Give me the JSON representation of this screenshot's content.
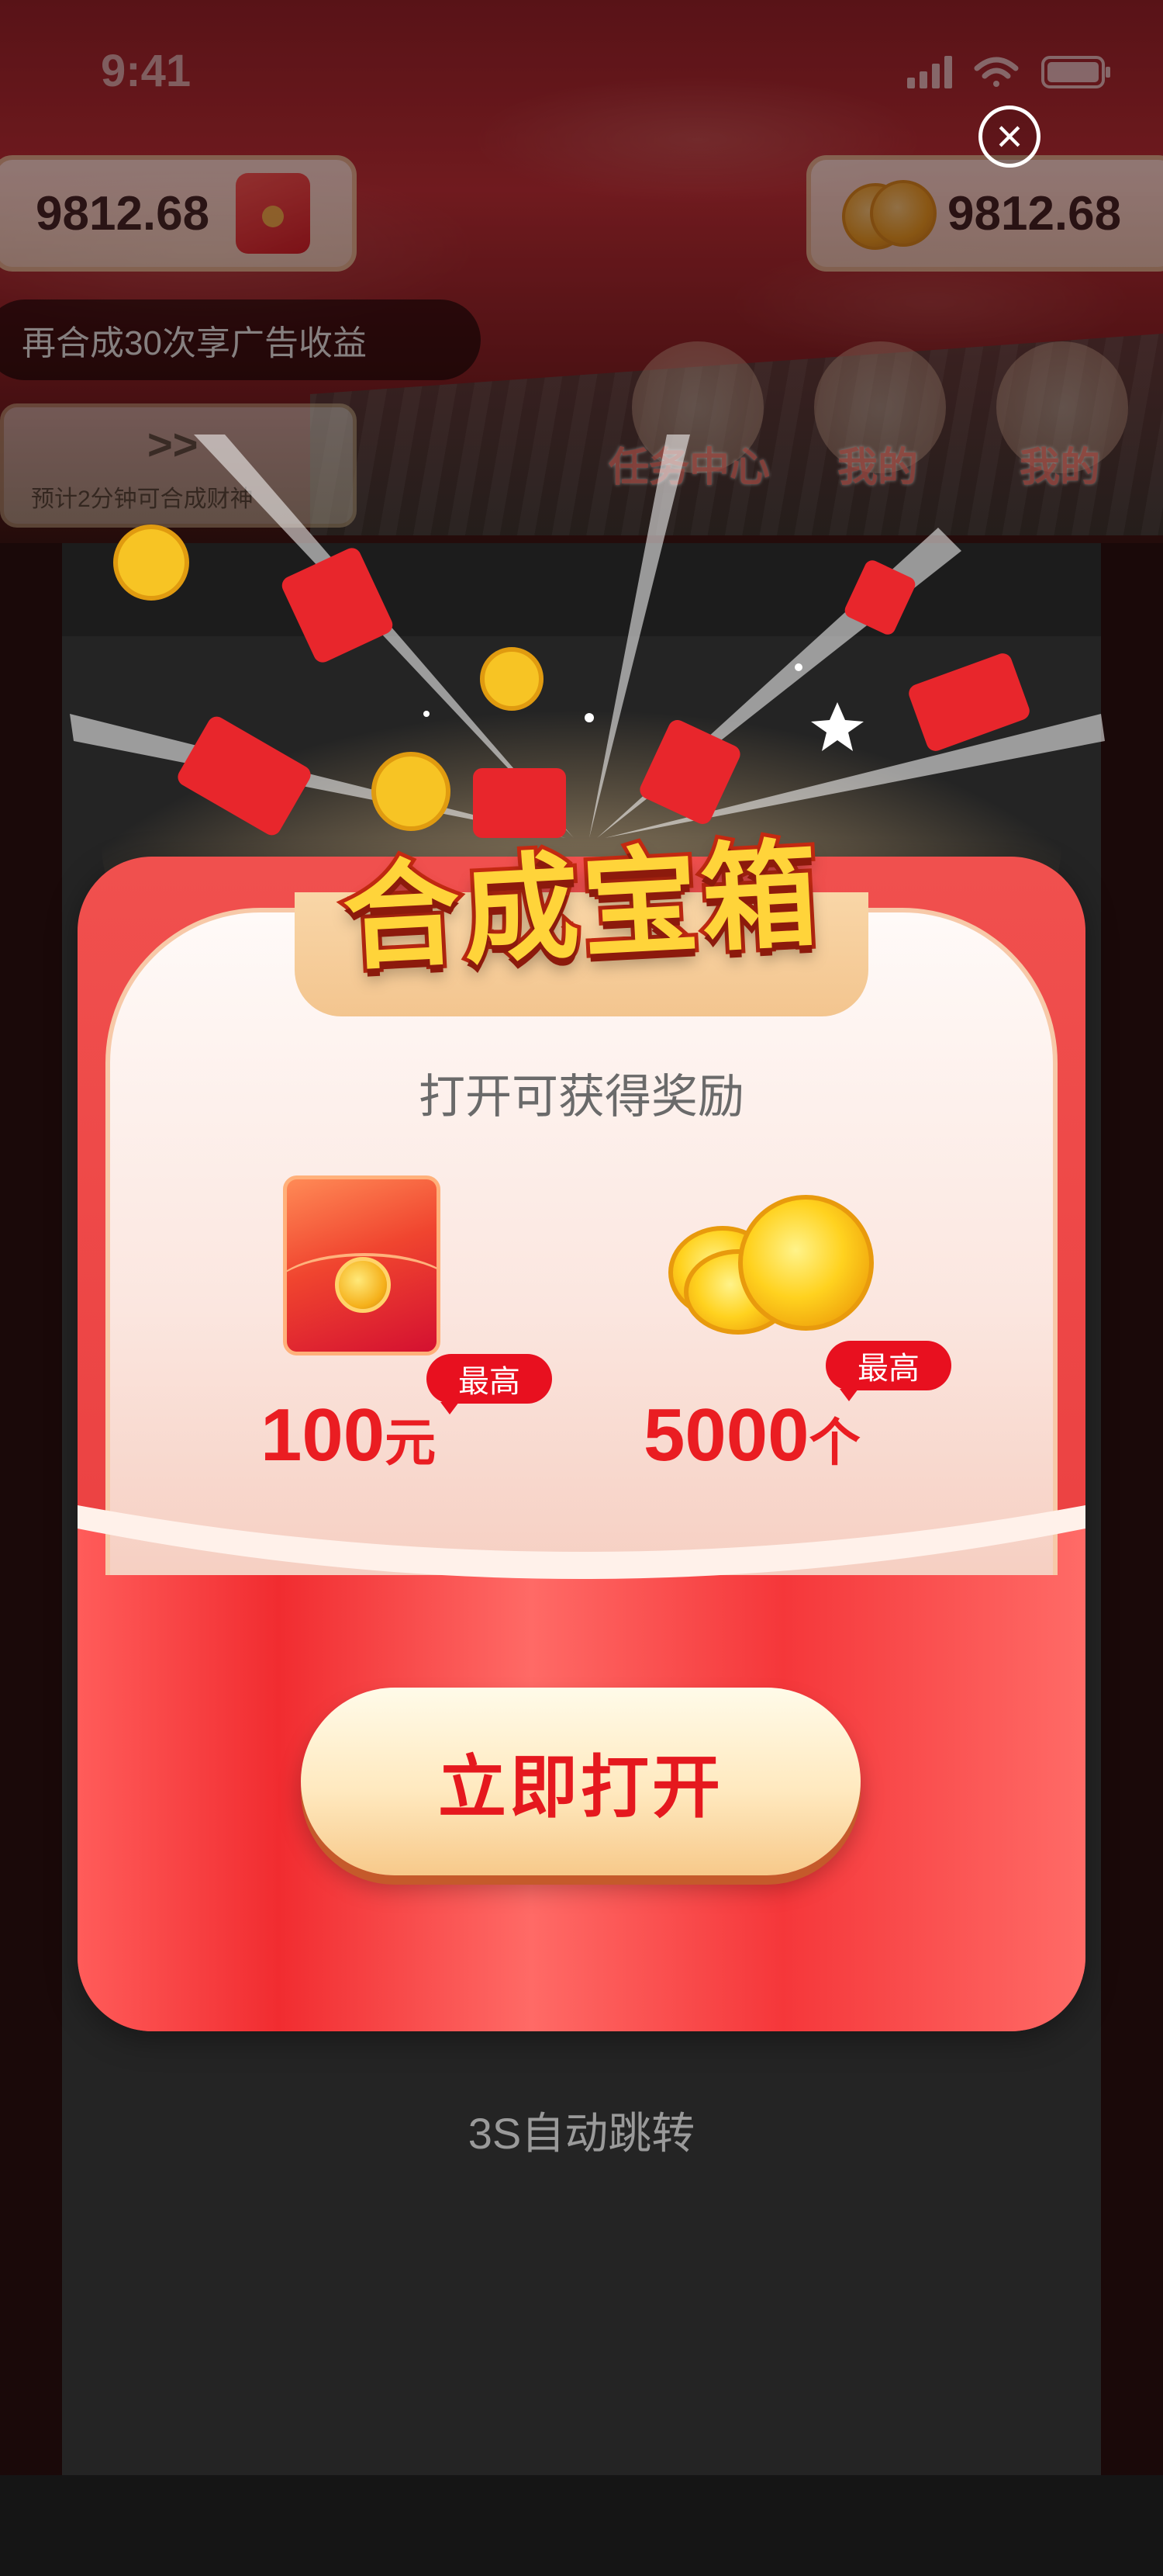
{
  "status_bar": {
    "time": "9:41"
  },
  "header": {
    "cash_balance": "9812.68",
    "coin_balance": "9812.68"
  },
  "background": {
    "ad_banner": "再合成30次享广告收益",
    "progress_text": "预计2分钟可合成财神",
    "nav": [
      {
        "label": "任务中心"
      },
      {
        "label": "我的"
      },
      {
        "label": "我的"
      }
    ]
  },
  "modal": {
    "title": "合成宝箱",
    "subtitle": "打开可获得奖励",
    "rewards": [
      {
        "badge": "最高",
        "amount": "100",
        "unit": "元",
        "icon": "red-packet-icon"
      },
      {
        "badge": "最高",
        "amount": "5000",
        "unit": "个",
        "icon": "gold-coins-icon"
      }
    ],
    "cta_label": "立即打开",
    "auto_jump_text": "3S自动跳转"
  },
  "colors": {
    "primary_red": "#e8383a",
    "accent_gold": "#ffd43a",
    "text_red": "#ea1d22",
    "cta_bg": "#ffe9bf"
  }
}
